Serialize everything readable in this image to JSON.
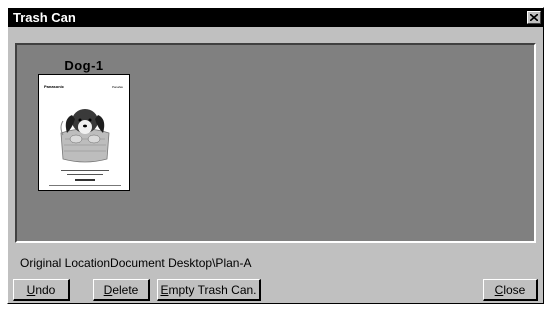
{
  "window": {
    "title": "Trash Can"
  },
  "items": [
    {
      "label": "Dog-1",
      "brand": "Panasonic",
      "brand_small": "Panafax"
    }
  ],
  "status": {
    "location_text": "Original LocationDocument Desktop\\Plan-A"
  },
  "buttons": {
    "undo": {
      "first": "U",
      "rest": "ndo"
    },
    "delete": {
      "first": "D",
      "rest": "elete"
    },
    "empty": {
      "first": "E",
      "rest": "mpty Trash Can."
    },
    "close": {
      "first": "C",
      "rest": "lose"
    }
  }
}
